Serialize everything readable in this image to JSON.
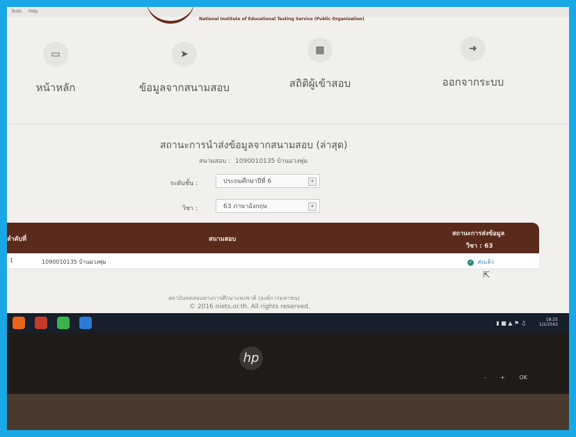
{
  "app": {
    "menu": [
      "Tools",
      "Help"
    ],
    "brand": "National Institute of Educational Testing Service (Public Organization)"
  },
  "nav": {
    "home": "หน้าหลัก",
    "center_data": "ข้อมูลจากสนามสอบ",
    "stats": "สถิติผู้เข้าสอบ",
    "logout": "ออกจากระบบ"
  },
  "page": {
    "title": "สถานะการนำส่งข้อมูลจากสนามสอบ (ล่าสุด)",
    "center_label": "สนามสอบ :",
    "center_value": "1090010135 บ้านม่วงพุ่ม"
  },
  "filters": {
    "level_label": "ระดับชั้น :",
    "level_value": "ประถมศึกษาปีที่ 6",
    "subject_label": "วิชา :",
    "subject_value": "63 ภาษาอังกฤษ"
  },
  "table": {
    "col_index": "ลำดับที่",
    "col_center": "สนามสอบ",
    "col_status_1": "สถานะการส่งข้อมูล",
    "col_status_2": "วิชา : 63",
    "rows": [
      {
        "index": "1",
        "center": "1090010135 บ้านม่วงพุ่ม",
        "status": "ส่งแล้ว"
      }
    ]
  },
  "footer": {
    "line1": "สถาบันทดสอบทางการศึกษาแห่งชาติ (องค์การมหาชน)",
    "line2": "© 2016 niets.or.th. All rights reserved."
  },
  "taskbar": {
    "time": "18:25",
    "date": "1/2/2563"
  },
  "monitor": {
    "brand": "hp",
    "buttons": [
      "-",
      "+",
      "OK"
    ]
  }
}
